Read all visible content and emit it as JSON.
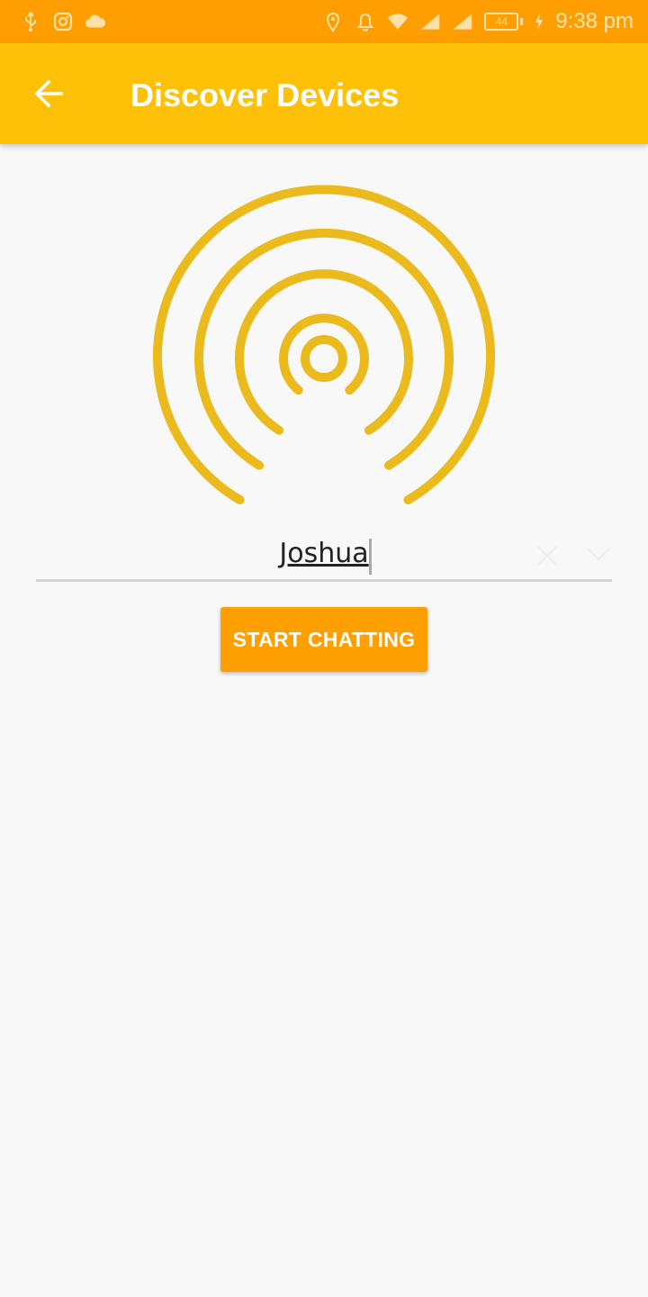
{
  "status_bar": {
    "time": "9:38 pm",
    "battery_level": "44",
    "icons_left": [
      "usb-icon",
      "instagram-icon",
      "cloud-icon"
    ],
    "icons_right": [
      "location-icon",
      "bell-icon",
      "wifi-icon",
      "signal-icon",
      "signal-icon",
      "battery-icon",
      "charging-icon"
    ]
  },
  "app_bar": {
    "title": "Discover Devices",
    "back_icon": "arrow-back-icon",
    "color": "#ffc107"
  },
  "discovery": {
    "graphic_icon": "broadcast-signal-icon",
    "graphic_color": "#ebbb1d"
  },
  "name_field": {
    "value": "Joshua",
    "clear_icon": "close-icon",
    "dropdown_icon": "chevron-down-icon"
  },
  "actions": {
    "start_label": "START CHATTING",
    "start_color": "#ff9f00"
  }
}
